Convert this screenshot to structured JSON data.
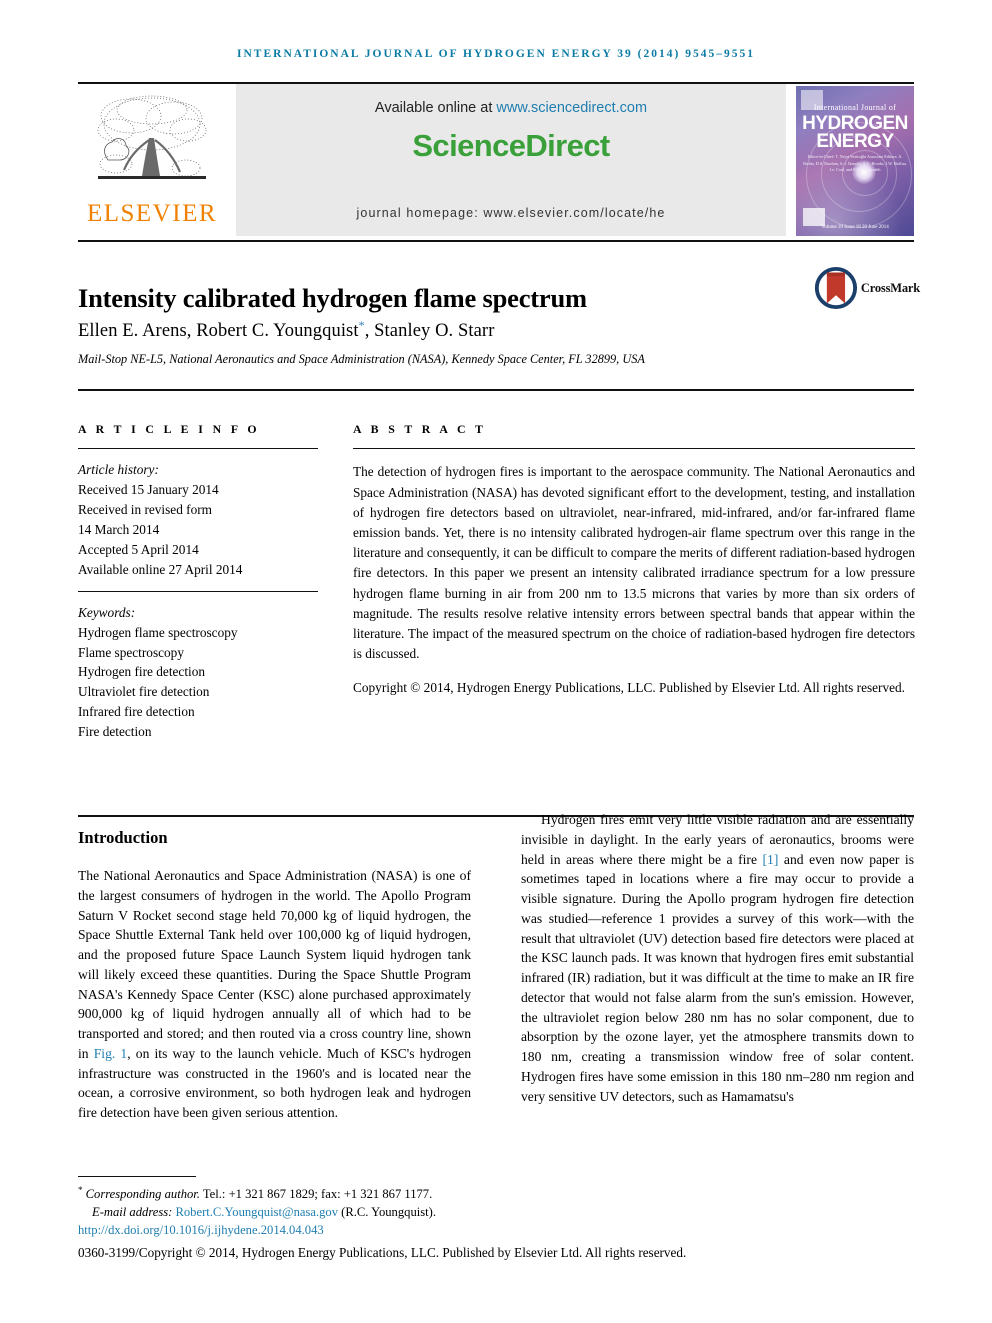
{
  "running_head": "International Journal of Hydrogen Energy 39 (2014) 9545–9551",
  "masthead": {
    "publisher_name": "ELSEVIER",
    "available_prefix": "Available online at ",
    "available_url": "www.sciencedirect.com",
    "sciencedirect_logo": "ScienceDirect",
    "journal_homepage": "journal homepage: www.elsevier.com/locate/he",
    "cover": {
      "elsevier_mark": "elsevier-mark",
      "line_small": "International Journal of",
      "line_big_1": "HYDROGEN",
      "line_big_2": "ENERGY",
      "editors": "Editor-in-Chief: T. Nejat Veziroğlu\nAssociate Editors: A. Brohn, D.S. Dunlum, S.-i. Ikeuchi, A.C. Brooks, I.W. Hoffuu, I.e. Cool, and F.A. Aminzadeh",
      "bottom_note": "Volume 39 Issue 18 20 June 2014",
      "sciencedirect_note": "ScienceDirect",
      "ihe_mark": "ihe-logo"
    }
  },
  "article": {
    "title": "Intensity calibrated hydrogen flame spectrum",
    "crossmark_label": "CrossMark",
    "authors": "Ellen E. Arens, Robert C. Youngquist",
    "authors_star": "*",
    "authors_rest": ", Stanley O. Starr",
    "affiliation": "Mail-Stop NE-L5, National Aeronautics and Space Administration (NASA), Kennedy Space Center, FL 32899, USA"
  },
  "article_info": {
    "section_label": "A R T I C L E  I N F O",
    "history_heading": "Article history:",
    "history": [
      "Received 15 January 2014",
      "Received in revised form",
      "14 March 2014",
      "Accepted 5 April 2014",
      "Available online 27 April 2014"
    ],
    "keywords_heading": "Keywords:",
    "keywords": [
      "Hydrogen flame spectroscopy",
      "Flame spectroscopy",
      "Hydrogen fire detection",
      "Ultraviolet fire detection",
      "Infrared fire detection",
      "Fire detection"
    ]
  },
  "abstract": {
    "section_label": "A B S T R A C T",
    "text": "The detection of hydrogen fires is important to the aerospace community. The National Aeronautics and Space Administration (NASA) has devoted significant effort to the development, testing, and installation of hydrogen fire detectors based on ultraviolet, near-infrared, mid-infrared, and/or far-infrared flame emission bands. Yet, there is no intensity calibrated hydrogen-air flame spectrum over this range in the literature and consequently, it can be difficult to compare the merits of different radiation-based hydrogen fire detectors. In this paper we present an intensity calibrated irradiance spectrum for a low pressure hydrogen flame burning in air from 200 nm to 13.5 microns that varies by more than six orders of magnitude. The results resolve relative intensity errors between spectral bands that appear within the literature. The impact of the measured spectrum on the choice of radiation-based hydrogen fire detectors is discussed.",
    "copyright": "Copyright © 2014, Hydrogen Energy Publications, LLC. Published by Elsevier Ltd. All rights reserved."
  },
  "body": {
    "intro_heading": "Introduction",
    "left_paragraph_1": "The National Aeronautics and Space Administration (NASA) is one of the largest consumers of hydrogen in the world. The Apollo Program Saturn V Rocket second stage held 70,000 kg of liquid hydrogen, the Space Shuttle External Tank held over 100,000 kg of liquid hydrogen, and the proposed future Space Launch System liquid hydrogen tank will likely exceed these quantities. During the Space Shuttle Program NASA's Kennedy Space Center (KSC) alone purchased approximately 900,000 kg of liquid hydrogen annually all of which had to be transported and stored; and then routed via a cross country line, shown in ",
    "left_fig_link": "Fig. 1",
    "left_paragraph_1_cont": ", on its way to the launch vehicle. Much of KSC's hydrogen infrastructure was constructed in the 1960's and is located near the ocean, a corrosive environment, so both hydrogen leak and hydrogen fire detection have been given serious attention.",
    "right_paragraph_1_a": "Hydrogen fires emit very little visible radiation and are essentially invisible in daylight. In the early years of aeronautics, brooms were held in areas where there might be a fire ",
    "right_ref_link": "[1]",
    "right_paragraph_1_b": " and even now paper is sometimes taped in locations where a fire may occur to provide a visible signature. During the Apollo program hydrogen fire detection was studied—reference 1 provides a survey of this work—with the result that ultraviolet (UV) detection based fire detectors were placed at the KSC launch pads. It was known that hydrogen fires emit substantial infrared (IR) radiation, but it was difficult at the time to make an IR fire detector that would not false alarm from the sun's emission. However, the ultraviolet region below 280 nm has no solar component, due to absorption by the ozone layer, yet the atmosphere transmits down to 180 nm, creating a transmission window free of solar content. Hydrogen fires have some emission in this 180 nm–280 nm region and very sensitive UV detectors, such as Hamamatsu's"
  },
  "footer": {
    "corresponding_star": "*",
    "corresponding_label": "Corresponding author.",
    "corresponding_contact": " Tel.: +1 321 867 1829; fax: +1 321 867 1177.",
    "email_label": "E-mail address: ",
    "email_address": "Robert.C.Youngquist@nasa.gov",
    "email_owner": " (R.C. Youngquist).",
    "doi": "http://dx.doi.org/10.1016/j.ijhydene.2014.04.043",
    "copyright_line": "0360-3199/Copyright © 2014, Hydrogen Energy Publications, LLC. Published by Elsevier Ltd. All rights reserved."
  },
  "colors": {
    "running_head": "#0b7ba5",
    "link": "#1f7eb0",
    "elsevier_orange": "#f08000",
    "sciencedirect_green": "#3aa03a",
    "crossmark_ring": "#1b3f6b",
    "crossmark_ribbon": "#c0392b"
  }
}
